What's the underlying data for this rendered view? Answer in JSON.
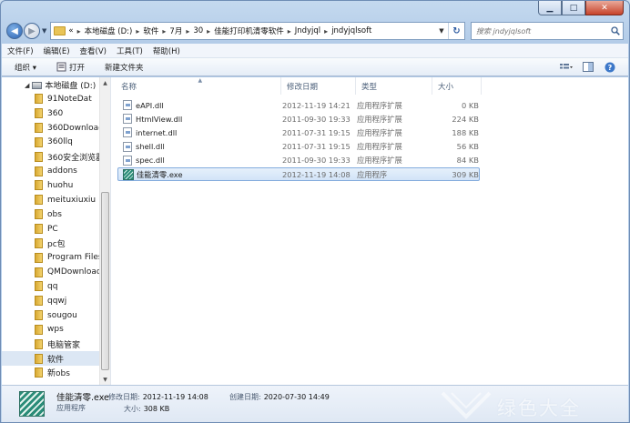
{
  "window": {
    "caption": {
      "minimize": "▁",
      "maximize": "□",
      "close": "✕"
    }
  },
  "address": {
    "prefix": "«",
    "crumbs": [
      "本地磁盘 (D:)",
      "软件",
      "7月",
      "30",
      "佳能打印机清零软件",
      "Jndyjql",
      "jndyjqlsoft"
    ]
  },
  "search": {
    "placeholder": "搜索 jndyjqlsoft"
  },
  "menu": [
    "文件(F)",
    "编辑(E)",
    "查看(V)",
    "工具(T)",
    "帮助(H)"
  ],
  "toolbar": {
    "organize": "组织 ▾",
    "open": "打开",
    "new_folder": "新建文件夹"
  },
  "tree": {
    "drive": "本地磁盘 (D:)",
    "items": [
      "91NoteDat",
      "360",
      "360Downloads",
      "360llq",
      "360安全浏览器",
      "addons",
      "huohu",
      "meituxiuxiu",
      "obs",
      "PC",
      "pc包",
      "Program Files",
      "QMDownload",
      "qq",
      "qqwj",
      "sougou",
      "wps",
      "电脑管家",
      "软件",
      "新obs"
    ],
    "selected_index": 18
  },
  "columns": {
    "name": "名称",
    "date": "修改日期",
    "type": "类型",
    "size": "大小"
  },
  "files": [
    {
      "name": "eAPI.dll",
      "date": "2012-11-19 14:21",
      "type": "应用程序扩展",
      "size": "0 KB",
      "kind": "dll"
    },
    {
      "name": "HtmlView.dll",
      "date": "2011-09-30 19:33",
      "type": "应用程序扩展",
      "size": "224 KB",
      "kind": "dll"
    },
    {
      "name": "internet.dll",
      "date": "2011-07-31 19:15",
      "type": "应用程序扩展",
      "size": "188 KB",
      "kind": "dll"
    },
    {
      "name": "shell.dll",
      "date": "2011-07-31 19:15",
      "type": "应用程序扩展",
      "size": "56 KB",
      "kind": "dll"
    },
    {
      "name": "spec.dll",
      "date": "2011-09-30 19:33",
      "type": "应用程序扩展",
      "size": "84 KB",
      "kind": "dll"
    },
    {
      "name": "佳能清零.exe",
      "date": "2012-11-19 14:08",
      "type": "应用程序",
      "size": "309 KB",
      "kind": "exe"
    }
  ],
  "selected_file_index": 5,
  "details": {
    "name": "佳能清零.exe",
    "type": "应用程序",
    "modified_label": "修改日期:",
    "modified": "2012-11-19 14:08",
    "created_label": "创建日期:",
    "created": "2020-07-30 14:49",
    "size_label": "大小:",
    "size": "308 KB"
  },
  "watermark": {
    "text": "绿色大全"
  },
  "colors": {
    "accent": "#2a62b1",
    "selection": "#d2e4f8",
    "folder": "#e9c457"
  }
}
